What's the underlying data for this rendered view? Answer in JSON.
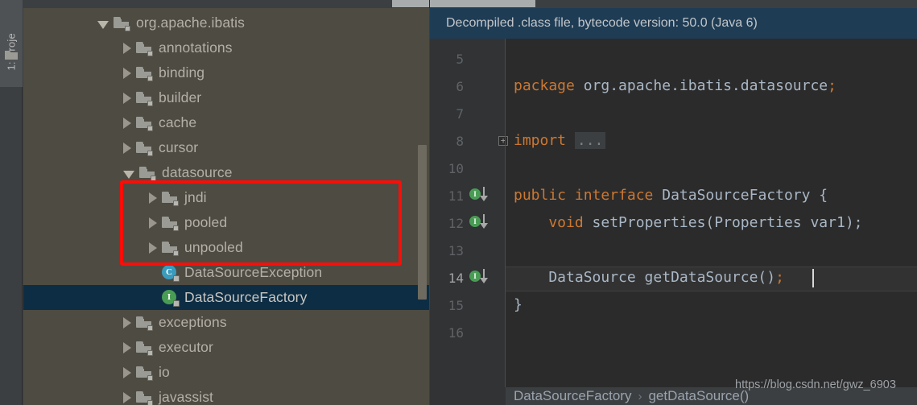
{
  "window": {
    "theme_bg": "#3c3f41",
    "tree_bg": "#4e4b42",
    "editor_bg": "#2b2b2b",
    "accent_selection": "#0d2d44",
    "annotation_color": "#fb0d08"
  },
  "tool_stripe": {
    "label": "1: Proje",
    "icon": "folder-icon"
  },
  "project_tree": {
    "rows": [
      {
        "label": "org.apache.ibatis",
        "indent": 0,
        "twisty": "open",
        "icon": "folder-icon",
        "selected": false
      },
      {
        "label": "annotations",
        "indent": 1,
        "twisty": "closed",
        "icon": "folder-icon",
        "selected": false
      },
      {
        "label": "binding",
        "indent": 1,
        "twisty": "closed",
        "icon": "folder-icon",
        "selected": false
      },
      {
        "label": "builder",
        "indent": 1,
        "twisty": "closed",
        "icon": "folder-icon",
        "selected": false
      },
      {
        "label": "cache",
        "indent": 1,
        "twisty": "closed",
        "icon": "folder-icon",
        "selected": false
      },
      {
        "label": "cursor",
        "indent": 1,
        "twisty": "closed",
        "icon": "folder-icon",
        "selected": false
      },
      {
        "label": "datasource",
        "indent": 1,
        "twisty": "open",
        "icon": "folder-icon",
        "selected": false
      },
      {
        "label": "jndi",
        "indent": 2,
        "twisty": "closed",
        "icon": "folder-icon",
        "selected": false
      },
      {
        "label": "pooled",
        "indent": 2,
        "twisty": "closed",
        "icon": "folder-icon",
        "selected": false
      },
      {
        "label": "unpooled",
        "indent": 2,
        "twisty": "closed",
        "icon": "folder-icon",
        "selected": false
      },
      {
        "label": "DataSourceException",
        "indent": 2,
        "twisty": "none",
        "icon": "class-icon",
        "glyph": "C",
        "glyph_color": "#3a9bbd",
        "selected": false
      },
      {
        "label": "DataSourceFactory",
        "indent": 2,
        "twisty": "none",
        "icon": "interface-icon",
        "glyph": "I",
        "glyph_color": "#499c54",
        "selected": true
      },
      {
        "label": "exceptions",
        "indent": 1,
        "twisty": "closed",
        "icon": "folder-icon",
        "selected": false
      },
      {
        "label": "executor",
        "indent": 1,
        "twisty": "closed",
        "icon": "folder-icon",
        "selected": false
      },
      {
        "label": "io",
        "indent": 1,
        "twisty": "closed",
        "icon": "folder-icon",
        "selected": false
      },
      {
        "label": "javassist",
        "indent": 1,
        "twisty": "closed",
        "icon": "folder-icon",
        "selected": false
      }
    ]
  },
  "annotation": {
    "name": "red-highlight-box",
    "encloses": [
      "jndi",
      "pooled",
      "unpooled"
    ]
  },
  "editor": {
    "notification": "Decompiled .class file, bytecode version: 50.0 (Java 6)",
    "line_numbers": [
      "5",
      "6",
      "7",
      "8",
      "10",
      "11",
      "12",
      "13",
      "14",
      "15",
      "16"
    ],
    "current_line_number": "14",
    "gutter_marks": [
      {
        "line": "11",
        "glyph": "I",
        "kind": "implemented-mark"
      },
      {
        "line": "12",
        "glyph": "I",
        "kind": "implemented-mark"
      },
      {
        "line": "14",
        "glyph": "I",
        "kind": "implemented-mark"
      }
    ],
    "fold_indicator": "+",
    "code_lines": [
      {
        "n": "5",
        "tokens": []
      },
      {
        "n": "6",
        "tokens": [
          {
            "t": "package ",
            "c": "kw"
          },
          {
            "t": "org.apache.ibatis.datasource",
            "c": "idn"
          },
          {
            "t": ";",
            "c": "kw"
          }
        ]
      },
      {
        "n": "7",
        "tokens": []
      },
      {
        "n": "8",
        "tokens": [
          {
            "t": "import ",
            "c": "kw"
          },
          {
            "t": "...",
            "c": "dots"
          }
        ]
      },
      {
        "n": "10",
        "tokens": []
      },
      {
        "n": "11",
        "tokens": [
          {
            "t": "public interface ",
            "c": "kw"
          },
          {
            "t": "DataSourceFactory",
            "c": "idn"
          },
          {
            "t": " {",
            "c": "pun"
          }
        ]
      },
      {
        "n": "12",
        "tokens": [
          {
            "t": "    void ",
            "c": "kw"
          },
          {
            "t": "setProperties(Properties var1);",
            "c": "idn"
          }
        ]
      },
      {
        "n": "13",
        "tokens": []
      },
      {
        "n": "14",
        "tokens": [
          {
            "t": "    DataSource getDataSource()",
            "c": "idn"
          },
          {
            "t": ";",
            "c": "kw"
          }
        ]
      },
      {
        "n": "15",
        "tokens": [
          {
            "t": "}",
            "c": "idn"
          }
        ]
      },
      {
        "n": "16",
        "tokens": []
      }
    ],
    "breadcrumb": {
      "items": [
        "DataSourceFactory",
        "getDataSource()"
      ],
      "separator": "›"
    }
  },
  "watermark": {
    "text": "https://blog.csdn.net/gwz_6903"
  }
}
